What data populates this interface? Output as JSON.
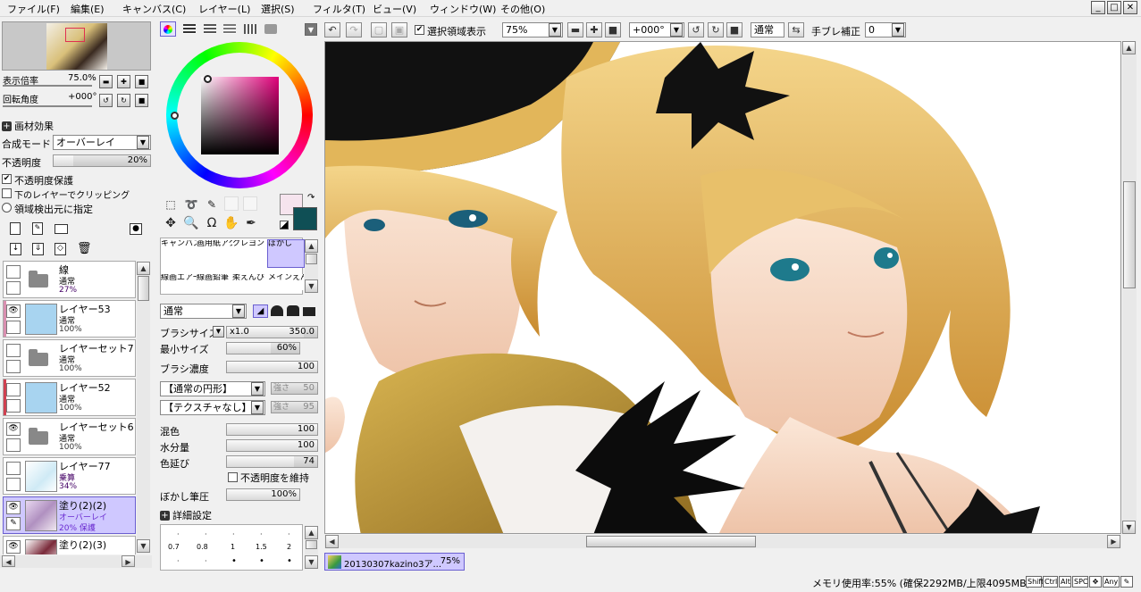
{
  "menu": [
    "ファイル(F)",
    "編集(E)",
    "キャンバス(C)",
    "レイヤー(L)",
    "選択(S)",
    "フィルタ(T)",
    "ビュー(V)",
    "ウィンドウ(W)",
    "その他(O)"
  ],
  "window_buttons": [
    "_",
    "□",
    "✕"
  ],
  "toolbar": {
    "selection_label": "選択領域表示",
    "zoom_value": "75%",
    "rotation_value": "+000°",
    "blend_mode": "通常",
    "stabilizer_label": "手ブレ補正",
    "stabilizer_value": "0"
  },
  "navigator": {
    "zoom_label": "表示倍率",
    "zoom_value": "75.0%",
    "rotation_label": "回転角度",
    "rotation_value": "+000°"
  },
  "layer_props": {
    "effects_label": "画材効果",
    "blend_label": "合成モード",
    "blend_value": "オーバーレイ",
    "opacity_label": "不透明度",
    "opacity_value": "20%",
    "opacity_fraction": 0.2,
    "protect_label": "不透明度保護",
    "clip_label": "下のレイヤーでクリッピング",
    "detect_label": "領域検出元に指定"
  },
  "layers": [
    {
      "name": "線",
      "mode": "通常",
      "opacity": "27%",
      "type": "folder",
      "visible": false,
      "selected": false,
      "mark": ""
    },
    {
      "name": "レイヤー53",
      "mode": "通常",
      "opacity": "100%",
      "type": "layer",
      "visible": false,
      "selected": false,
      "mark": "#d98fb0"
    },
    {
      "name": "レイヤーセット7",
      "mode": "通常",
      "opacity": "100%",
      "type": "folder",
      "visible": false,
      "selected": false,
      "mark": ""
    },
    {
      "name": "レイヤー52",
      "mode": "通常",
      "opacity": "100%",
      "type": "layer",
      "visible": false,
      "selected": false,
      "mark": "#d04050"
    },
    {
      "name": "レイヤーセット6",
      "mode": "通常",
      "opacity": "100%",
      "type": "folder",
      "visible": true,
      "selected": false,
      "mark": ""
    },
    {
      "name": "レイヤー77",
      "mode": "乗算",
      "opacity": "34%",
      "type": "layer",
      "visible": false,
      "selected": false,
      "mark": ""
    },
    {
      "name": "塗り(2)(2)",
      "mode": "オーバーレイ",
      "opacity": "20%  保護",
      "type": "layer",
      "visible": true,
      "selected": true,
      "mark": ""
    },
    {
      "name": "塗り(2)(3)",
      "mode": "",
      "opacity": "",
      "type": "layer",
      "visible": true,
      "selected": false,
      "mark": ""
    }
  ],
  "brushes": [
    "キャンバスアクリル",
    "画用紙アクリル",
    "クレヨン",
    "ぼかし",
    "線画エアー",
    "線画鉛筆",
    "柔えんぴ",
    "メインえんぴ"
  ],
  "brush_settings": {
    "mode": "通常",
    "size_label": "ブラシサイズ",
    "size_mult": "x1.0",
    "size_value": "350.0",
    "min_size_label": "最小サイズ",
    "min_size_value": "60%",
    "density_label": "ブラシ濃度",
    "density_value": "100",
    "shape_value": "【通常の円形】",
    "shape_strength_label": "強さ",
    "shape_strength_value": "50",
    "texture_value": "【テクスチャなし】",
    "texture_strength_label": "強さ",
    "texture_strength_value": "95",
    "blend_label": "混色",
    "blend_value": "100",
    "water_label": "水分量",
    "water_value": "100",
    "stretch_label": "色延び",
    "stretch_value": "74",
    "keep_opacity_label": "不透明度を維持",
    "blur_pressure_label": "ぼかし筆圧",
    "blur_pressure_value": "100%",
    "details_label": "詳細設定",
    "dot_sizes": [
      "0.7",
      "0.8",
      "1",
      "1.5",
      "2"
    ]
  },
  "document_tab": {
    "name": "20130307kazino3ア...",
    "zoom": "75%"
  },
  "status": {
    "memory": "メモリ使用率:55% (確保2292MB/上限4095MB)",
    "keys": [
      "Shift",
      "Ctrl",
      "Alt",
      "SPC",
      "✥",
      "Any",
      "✎"
    ]
  },
  "colors": {
    "main": "#0f4f55",
    "sub": "#f6e4ee",
    "accent": "#cfc8ff"
  }
}
